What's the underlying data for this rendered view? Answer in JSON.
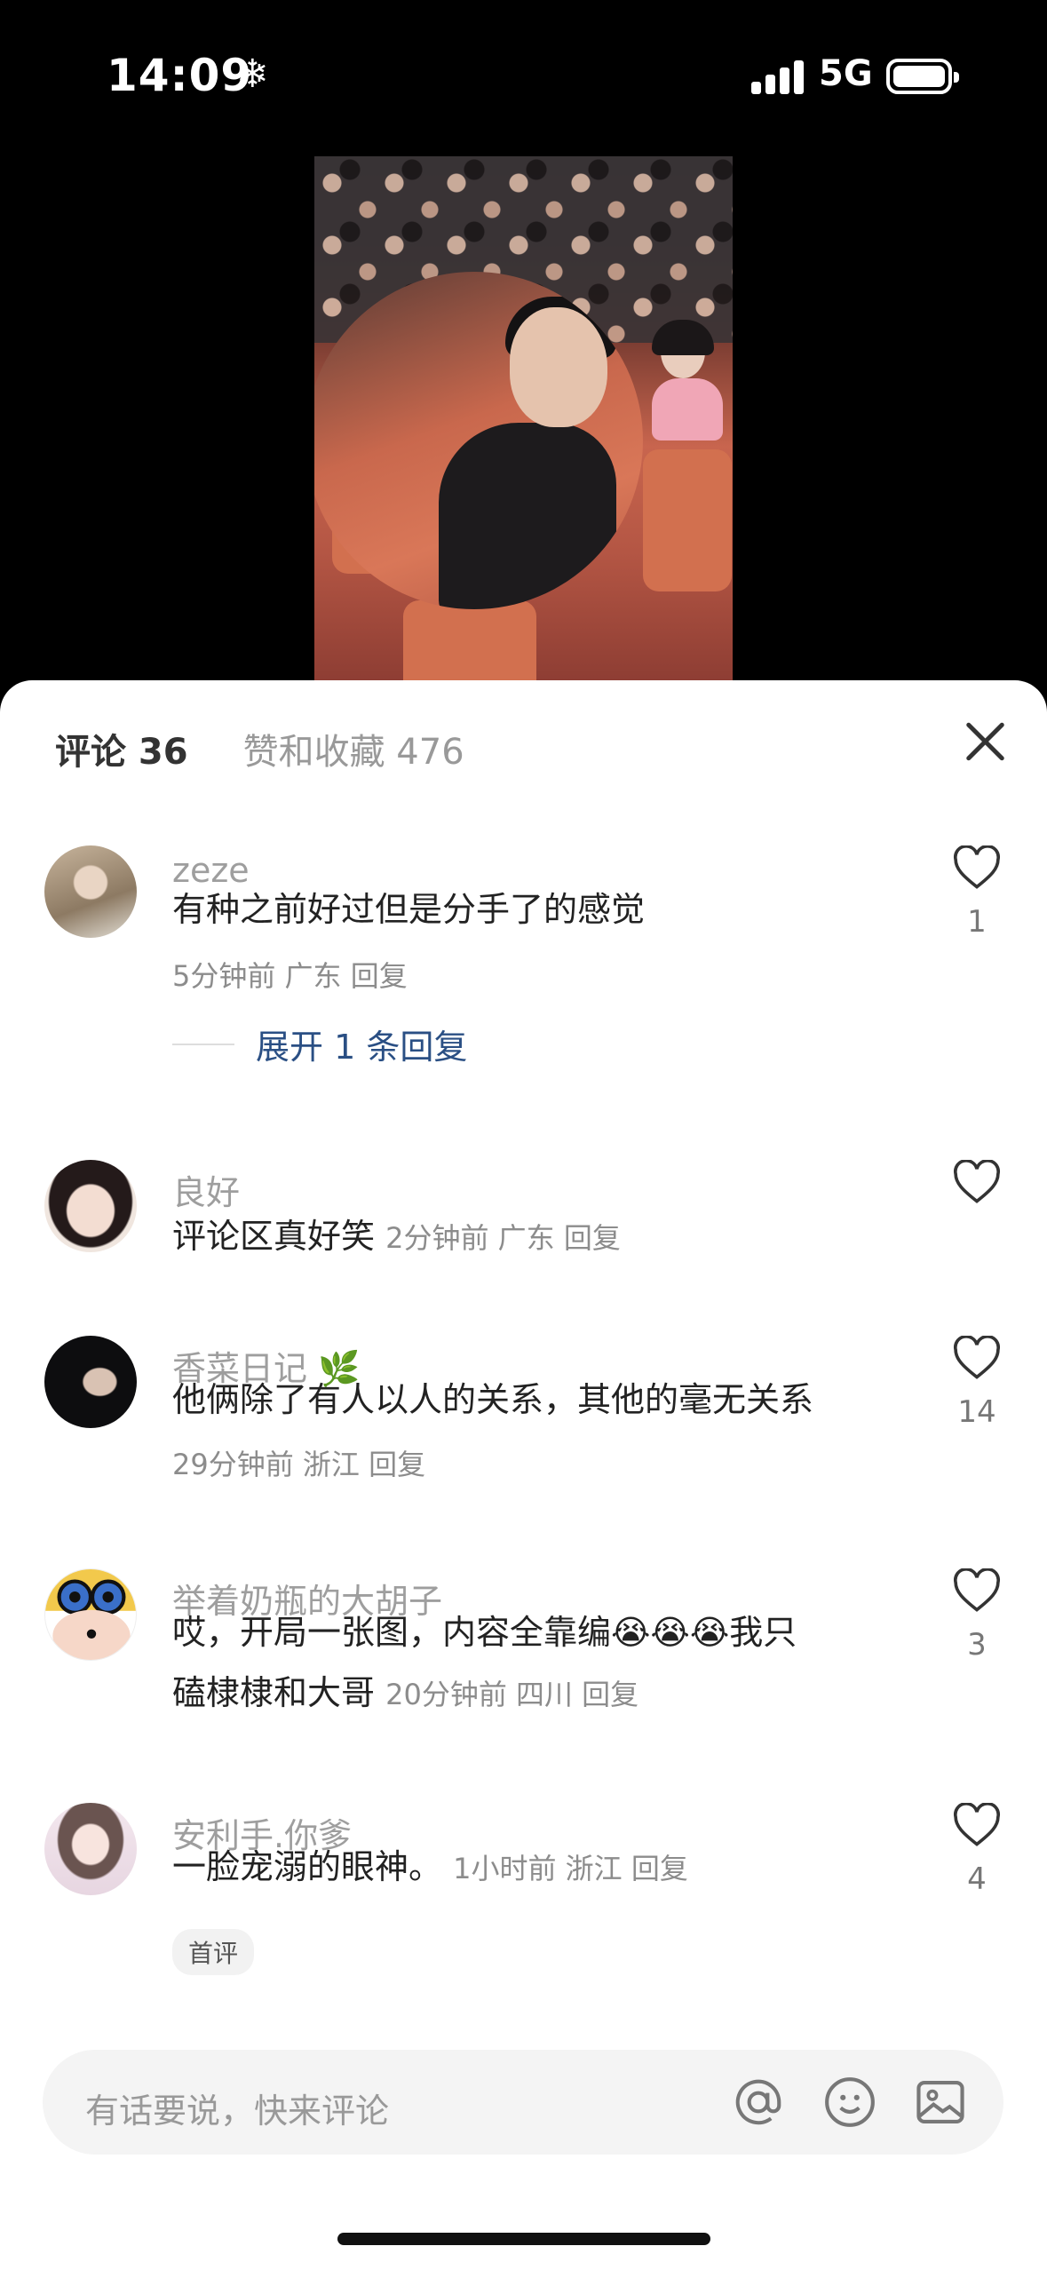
{
  "status_bar": {
    "time": "14:09",
    "time_icon": "snowflake-icon",
    "network": "5G"
  },
  "video": {
    "description_icon": "video-thumbnail"
  },
  "header": {
    "comments_tab": "评论 36",
    "likes_tab": "赞和收藏 476"
  },
  "comments": [
    {
      "user": "zeze",
      "text": "有种之前好过但是分手了的感觉",
      "meta": "5分钟前 广东 回复",
      "likes": "1",
      "expand": "展开 1 条回复"
    },
    {
      "user": "良好",
      "text": "评论区真好笑",
      "meta": "2分钟前 广东 回复",
      "likes": ""
    },
    {
      "user": "香菜日记",
      "user_icon": "leaf-icon",
      "text": "他俩除了有人以人的关系，其他的毫无关系",
      "meta": "29分钟前 浙江 回复",
      "likes": "14"
    },
    {
      "user": "举着奶瓶的大胡子",
      "text_line1": "哎，开局一张图，内容全靠编",
      "emoji": "crying-emoji",
      "text_line1_tail": "我只",
      "text_line2": "磕棣棣和大哥",
      "meta": "20分钟前 四川 回复",
      "likes": "3"
    },
    {
      "user": "安利手.你爹",
      "text": "一脸宠溺的眼神。",
      "meta": "1小时前 浙江 回复",
      "likes": "4",
      "badge": "首评"
    }
  ],
  "input": {
    "placeholder": "有话要说，快来评论"
  },
  "icons": {
    "mention": "at-icon",
    "emoji": "smiley-icon",
    "image": "image-icon"
  }
}
